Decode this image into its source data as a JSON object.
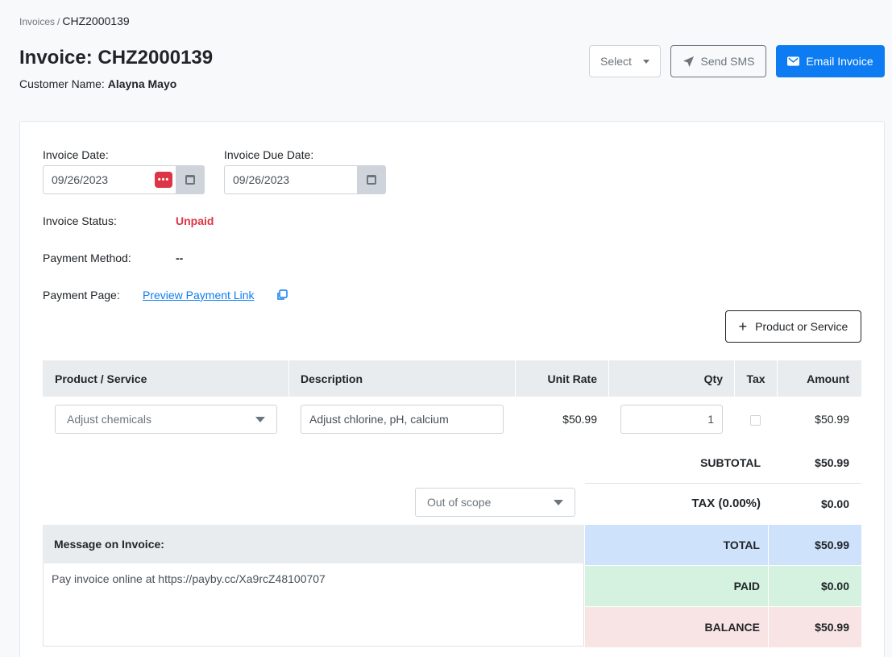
{
  "breadcrumb": {
    "root": "Invoices",
    "separator": "/",
    "current": "CHZ2000139"
  },
  "header": {
    "title": "Invoice: CHZ2000139",
    "customer_label": "Customer Name:",
    "customer_name": "Alayna Mayo"
  },
  "toolbar": {
    "select_label": "Select",
    "sms_label": "Send SMS",
    "email_label": "Email Invoice"
  },
  "dates": {
    "invoice_date_label": "Invoice Date:",
    "invoice_date_value": "09/26/2023",
    "due_date_label": "Invoice Due Date:",
    "due_date_value": "09/26/2023",
    "password_icon_text": "•••"
  },
  "info": {
    "status_label": "Invoice Status:",
    "status_value": "Unpaid",
    "method_label": "Payment Method:",
    "method_value": "--",
    "page_label": "Payment Page:",
    "page_link": "Preview Payment Link"
  },
  "add_button_label": "Product or Service",
  "table": {
    "headers": [
      "Product / Service",
      "Description",
      "Unit Rate",
      "Qty",
      "Tax",
      "Amount"
    ],
    "rows": [
      {
        "product": "Adjust chemicals",
        "description": "Adjust chlorine, pH, calcium",
        "unit_rate": "$50.99",
        "qty": "1",
        "tax": false,
        "amount": "$50.99"
      }
    ]
  },
  "totals": {
    "subtotal_label": "SUBTOTAL",
    "subtotal_value": "$50.99",
    "tax_select": "Out of scope",
    "tax_label": "TAX (0.00%)",
    "tax_value": "$0.00",
    "total_label": "TOTAL",
    "total_value": "$50.99",
    "paid_label": "PAID",
    "paid_value": "$0.00",
    "balance_label": "BALANCE",
    "balance_value": "$50.99"
  },
  "message": {
    "label": "Message on Invoice:",
    "text": "Pay invoice online at https://payby.cc/Xa9rcZ48100707"
  },
  "colors": {
    "primary": "#0d7cf2",
    "danger": "#dc3545",
    "total_bg": "#cfe2fc",
    "paid_bg": "#d4f2df",
    "balance_bg": "#f8e4e4"
  }
}
